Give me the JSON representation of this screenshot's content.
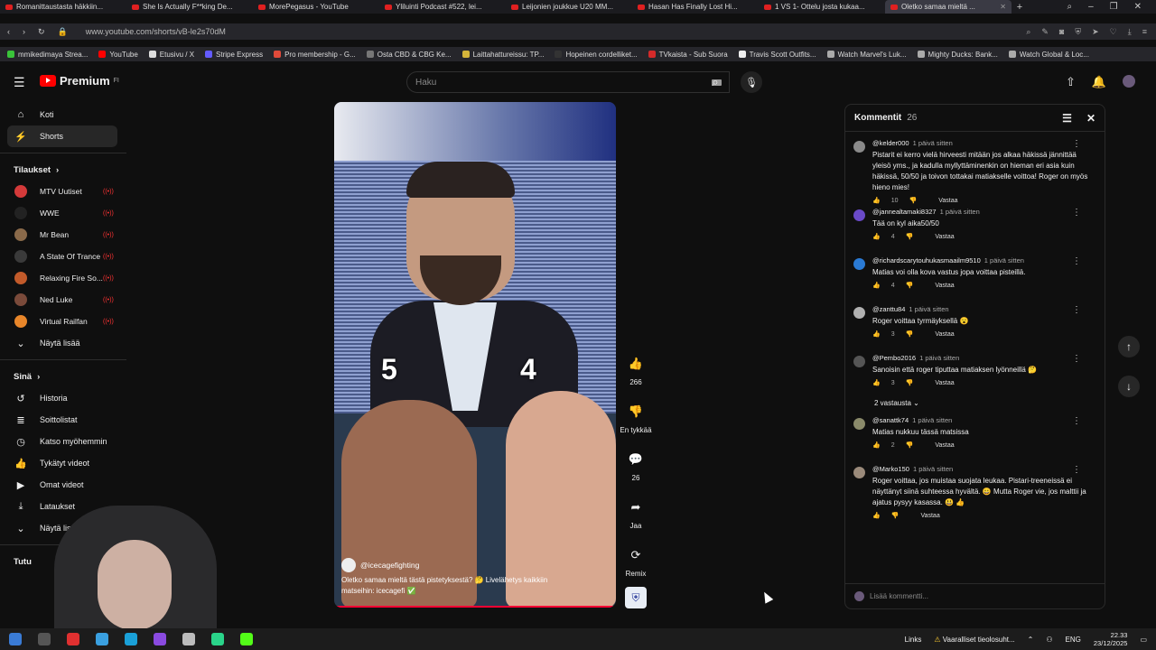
{
  "browser": {
    "tabs": [
      {
        "label": "Romanittaustasta häkkiin..."
      },
      {
        "label": "She Is Actually F**king De..."
      },
      {
        "label": "MorePegasus - YouTube"
      },
      {
        "label": "Yliluinti Podcast #522, lei..."
      },
      {
        "label": "Leijonien joukkue U20 MM..."
      },
      {
        "label": "Hasan Has Finally Lost Hi..."
      },
      {
        "label": "1 VS 1- Ottelu josta kukaa..."
      },
      {
        "label": "Oletko samaa mieltä ..."
      }
    ],
    "new_tab": "+",
    "url": "www.youtube.com/shorts/vB-le2s70dM",
    "bookmarks": [
      {
        "label": "mmikedimaya Strea..."
      },
      {
        "label": "YouTube"
      },
      {
        "label": "Etusivu / X"
      },
      {
        "label": "Stripe Express"
      },
      {
        "label": "Pro membership - G..."
      },
      {
        "label": "Osta CBD & CBG Ke..."
      },
      {
        "label": "Laittahattureissu: TP..."
      },
      {
        "label": "Hopeinen cordelliket..."
      },
      {
        "label": "TVkaista - Sub Suora"
      },
      {
        "label": "Travis Scott Outfits..."
      },
      {
        "label": "Watch Marvel's Luk..."
      },
      {
        "label": "Mighty Ducks: Bank..."
      },
      {
        "label": "Watch Global & Loc..."
      }
    ]
  },
  "header": {
    "logo": "Premium",
    "logo_sup": "FI",
    "search_placeholder": "Haku"
  },
  "sidebar": {
    "main": [
      {
        "label": "Koti",
        "icon": "home-icon"
      },
      {
        "label": "Shorts",
        "icon": "shorts-icon"
      }
    ],
    "subs_title": "Tilaukset",
    "subs": [
      {
        "label": "MTV Uutiset",
        "color": "#d43a3a"
      },
      {
        "label": "WWE",
        "color": "#222222"
      },
      {
        "label": "Mr Bean",
        "color": "#8a6a4a"
      },
      {
        "label": "A State Of Trance",
        "color": "#3a3a3a"
      },
      {
        "label": "Relaxing Fire So...",
        "color": "#c25a2a"
      },
      {
        "label": "Ned Luke",
        "color": "#7a4a3a"
      },
      {
        "label": "Virtual Railfan",
        "color": "#e8862a"
      }
    ],
    "show_more": "Näytä lisää",
    "you_title": "Sinä",
    "you": [
      {
        "label": "Historia"
      },
      {
        "label": "Soittolistat"
      },
      {
        "label": "Katso myöhemmin"
      },
      {
        "label": "Tykätyt videot"
      },
      {
        "label": "Omat videot"
      },
      {
        "label": "Lataukset"
      },
      {
        "label": "Näytä lisää"
      }
    ],
    "tutu": "Tutu"
  },
  "video": {
    "score_left": "5",
    "score_right": "4",
    "channel": "@icecagefighting",
    "caption_line1": "Oletko samaa mieltä tästä pistetyksestä? 🤔 Livelähetys kaikkiin",
    "caption_line2": "matseihin: icecagefi ✅",
    "progress": 1.0
  },
  "actions": {
    "likes": "266",
    "dislike_label": "En tykkää",
    "comments": "26",
    "share": "Jaa",
    "remix": "Remix"
  },
  "comments": {
    "title": "Kommentit",
    "count": "26",
    "items": [
      {
        "user": "@kelder000",
        "when": "1 päivä sitten",
        "text": "Pistarit ei kerro vielä hirveesti mitään jos alkaa häkissä jännittää yleisö yms., ja kadulla myllyttäminenkin on hieman eri asia kuin häkissä, 50/50 ja toivon tottakai matiakselle voittoa! Roger on myös hieno mies!",
        "likes": "10",
        "color": "#8a8a8a"
      },
      {
        "user": "@jannealtamaki8327",
        "when": "1 päivä sitten",
        "text": "Tää on kyl aika50/50",
        "likes": "4",
        "color": "#6a4ac8"
      },
      {
        "user": "@richardscarytouhukasmaailm9510",
        "when": "1 päivä sitten",
        "text": "Matias voi olla kova vastus jopa voittaa pisteillä.",
        "likes": "4",
        "color": "#2a7ad4"
      },
      {
        "user": "@zanttu84",
        "when": "1 päivä sitten",
        "text": "Roger voittaa tyrmäyksellä 😮",
        "likes": "3",
        "color": "#b0b0b0"
      },
      {
        "user": "@Pembo2016",
        "when": "1 päivä sitten",
        "text": "Sanoisin että roger tiputtaa matiaksen lyönneillä 🤔",
        "likes": "3",
        "color": "#555555"
      },
      {
        "user": "@sanattk74",
        "when": "1 päivä sitten",
        "text": "Matias nukkuu tässä matsissa",
        "likes": "2",
        "color": "#8a8a6a"
      },
      {
        "user": "@Marko150",
        "when": "1 päivä sitten",
        "text": "Roger voittaa, jos muistaa suojata leukaa. Pistari-treeneissä ei näyttänyt siinä suhteessa hyvältä. 😀 Mutta Roger vie, jos malttii ja ajatus pysyy kasassa. 😃 👍",
        "likes": "",
        "color": "#9a8a7a"
      }
    ],
    "reply_label": "Vastaa",
    "replies_toggle": "2 vastausta",
    "add_placeholder": "Lisää kommentti..."
  },
  "taskbar": {
    "links": "Links",
    "warning": "Vaaralliset tieolosuht...",
    "lang": "ENG",
    "time": "22.33",
    "date": "23/12/2025"
  }
}
